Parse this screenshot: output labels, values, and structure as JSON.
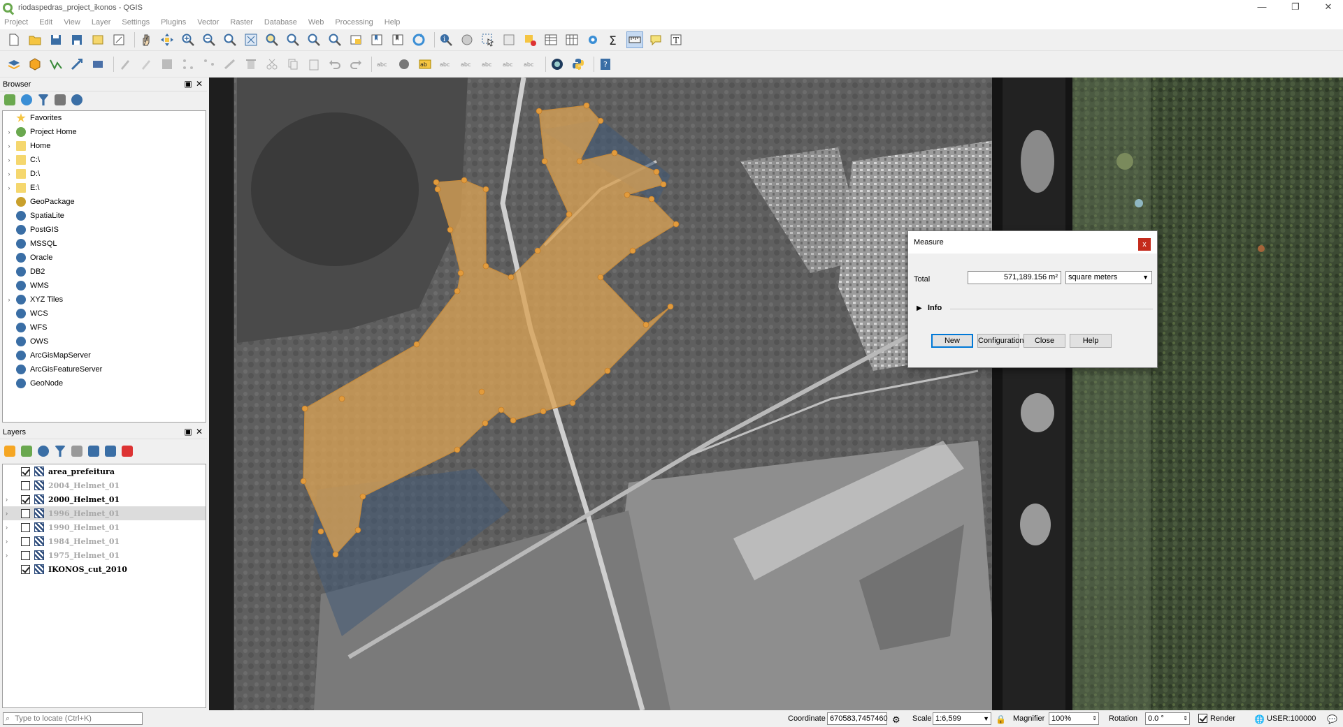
{
  "window": {
    "title": "riodaspedras_project_ikonos - QGIS",
    "minimize": "—",
    "restore": "❐",
    "close": "✕"
  },
  "menu": [
    "Project",
    "Edit",
    "View",
    "Layer",
    "Settings",
    "Plugins",
    "Vector",
    "Raster",
    "Database",
    "Web",
    "Processing",
    "Help"
  ],
  "browser": {
    "title": "Browser",
    "items": [
      {
        "label": "Favorites",
        "icon": "star-icon",
        "expand": false
      },
      {
        "label": "Project Home",
        "icon": "project-home-icon",
        "expand": true
      },
      {
        "label": "Home",
        "icon": "folder-icon",
        "expand": true
      },
      {
        "label": "C:\\",
        "icon": "folder-icon",
        "expand": true
      },
      {
        "label": "D:\\",
        "icon": "folder-icon",
        "expand": true
      },
      {
        "label": "E:\\",
        "icon": "folder-icon",
        "expand": true
      },
      {
        "label": "GeoPackage",
        "icon": "geopackage-icon",
        "expand": false
      },
      {
        "label": "SpatiaLite",
        "icon": "spatialite-icon",
        "expand": false
      },
      {
        "label": "PostGIS",
        "icon": "postgis-icon",
        "expand": false
      },
      {
        "label": "MSSQL",
        "icon": "mssql-icon",
        "expand": false
      },
      {
        "label": "Oracle",
        "icon": "oracle-icon",
        "expand": false
      },
      {
        "label": "DB2",
        "icon": "db2-icon",
        "expand": false
      },
      {
        "label": "WMS",
        "icon": "wms-icon",
        "expand": false
      },
      {
        "label": "XYZ Tiles",
        "icon": "xyz-tiles-icon",
        "expand": true
      },
      {
        "label": "WCS",
        "icon": "wcs-icon",
        "expand": false
      },
      {
        "label": "WFS",
        "icon": "wfs-icon",
        "expand": false
      },
      {
        "label": "OWS",
        "icon": "ows-icon",
        "expand": false
      },
      {
        "label": "ArcGisMapServer",
        "icon": "arcgis-mapserver-icon",
        "expand": false
      },
      {
        "label": "ArcGisFeatureServer",
        "icon": "arcgis-featureserver-icon",
        "expand": false
      },
      {
        "label": "GeoNode",
        "icon": "geonode-icon",
        "expand": false
      }
    ]
  },
  "layers": {
    "title": "Layers",
    "items": [
      {
        "label": "area_prefeitura",
        "checked": true,
        "bold": true,
        "dim": false,
        "expand": false,
        "selected": false,
        "type": "vector"
      },
      {
        "label": "2004_Helmet_01",
        "checked": false,
        "bold": true,
        "dim": true,
        "expand": false,
        "selected": false,
        "type": "raster"
      },
      {
        "label": "2000_Helmet_01",
        "checked": true,
        "bold": true,
        "dim": false,
        "expand": true,
        "selected": false,
        "type": "raster"
      },
      {
        "label": "1996_Helmet_01",
        "checked": false,
        "bold": true,
        "dim": true,
        "expand": true,
        "selected": true,
        "type": "raster"
      },
      {
        "label": "1990_Helmet_01",
        "checked": false,
        "bold": true,
        "dim": true,
        "expand": true,
        "selected": false,
        "type": "raster"
      },
      {
        "label": "1984_Helmet_01",
        "checked": false,
        "bold": true,
        "dim": true,
        "expand": true,
        "selected": false,
        "type": "raster"
      },
      {
        "label": "1975_Helmet_01",
        "checked": false,
        "bold": true,
        "dim": true,
        "expand": true,
        "selected": false,
        "type": "raster"
      },
      {
        "label": "IKONOS_cut_2010",
        "checked": true,
        "bold": true,
        "dim": false,
        "expand": false,
        "selected": false,
        "type": "raster"
      }
    ]
  },
  "measure": {
    "title": "Measure",
    "close": "x",
    "total_label": "Total",
    "total_value": "571,189.156 m²",
    "unit": "square meters",
    "info_label": "Info",
    "buttons": {
      "new": "New",
      "configuration": "Configuration",
      "close": "Close",
      "help": "Help"
    }
  },
  "status": {
    "locate_placeholder": "Type to locate (Ctrl+K)",
    "coordinate_label": "Coordinate",
    "coordinate": "670583,7457460",
    "scale_label": "Scale",
    "scale": "1:6,599",
    "magnifier_label": "Magnifier",
    "magnifier": "100%",
    "rotation_label": "Rotation",
    "rotation": "0.0 °",
    "render_label": "Render",
    "crs": "USER:100000"
  },
  "colors": {
    "polygon_fill": "#d9a155",
    "vertex": "#e29b3c",
    "accent": "#0078d7"
  }
}
